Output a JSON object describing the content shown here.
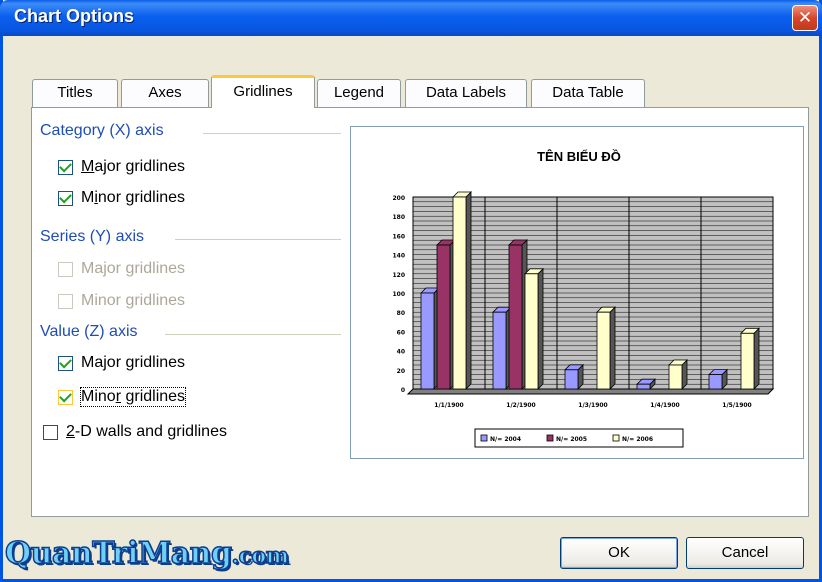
{
  "window": {
    "title": "Chart Options",
    "close_symbol": "✕"
  },
  "tabs": [
    {
      "label": "Titles"
    },
    {
      "label": "Axes"
    },
    {
      "label": "Gridlines"
    },
    {
      "label": "Legend"
    },
    {
      "label": "Data Labels"
    },
    {
      "label": "Data Table"
    }
  ],
  "active_tab": "Gridlines",
  "groups": {
    "category": {
      "title": "Category (X) axis",
      "major": {
        "pre": "",
        "key": "M",
        "post": "ajor gridlines",
        "checked": true
      },
      "minor": {
        "pre": "M",
        "key": "i",
        "post": "nor gridlines",
        "checked": true
      }
    },
    "series": {
      "title": "Series (Y) axis",
      "major": {
        "label": "Major gridlines",
        "checked": false,
        "disabled": true
      },
      "minor": {
        "label": "Minor gridlines",
        "checked": false,
        "disabled": true
      }
    },
    "value": {
      "title": "Value (Z) axis",
      "major": {
        "pre": "Ma",
        "key": "j",
        "post": "or gridlines",
        "checked": true
      },
      "minor": {
        "pre": "Mino",
        "key": "r",
        "post": " gridlines",
        "checked": true
      }
    },
    "walls": {
      "pre": "",
      "key": "2",
      "post": "-D walls and gridlines",
      "checked": false
    }
  },
  "buttons": {
    "ok": "OK",
    "cancel": "Cancel"
  },
  "watermark": {
    "main": "QuanTriMang",
    "suffix": ".com"
  },
  "colors": {
    "series_2004": "#9999FF",
    "series_2005": "#993366",
    "series_2006": "#FFFFCC",
    "plot_bg": "#C0C0C0",
    "focus_border": "#FFC83C",
    "title_blue": "#0054E3"
  },
  "chart_data": {
    "type": "bar",
    "title": "TÊN BIỂU ĐỒ",
    "categories": [
      "1/1/1900",
      "1/2/1900",
      "1/3/1900",
      "1/4/1900",
      "1/5/1900"
    ],
    "series": [
      {
        "name": "N/= 2004",
        "values": [
          100,
          80,
          20,
          5,
          15
        ]
      },
      {
        "name": "N/= 2005",
        "values": [
          150,
          150,
          0,
          0,
          0
        ]
      },
      {
        "name": "N/= 2006",
        "values": [
          200,
          120,
          80,
          25,
          58
        ]
      }
    ],
    "y_ticks": [
      0,
      20,
      40,
      60,
      80,
      100,
      120,
      140,
      160,
      180,
      200
    ],
    "ylim": [
      0,
      200
    ],
    "grid": true,
    "legend": "bottom"
  }
}
